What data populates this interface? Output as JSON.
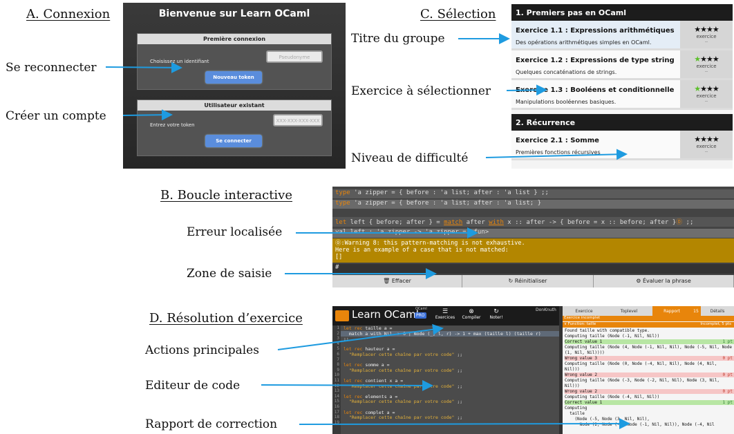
{
  "captions": {
    "a": "A. Connexion",
    "b": "B. Boucle interactive",
    "c": "C. Sélection",
    "d": "D. Résolution d’exercice"
  },
  "labels": {
    "reconnect": "Se reconnecter",
    "create": "Créer un compte",
    "group_title": "Titre du groupe",
    "exercise_select": "Exercice à sélectionner",
    "difficulty": "Niveau de difficulté",
    "error": "Erreur localisée",
    "input_zone": "Zone de saisie",
    "main_actions": "Actions principales",
    "code_editor": "Editeur de code",
    "report": "Rapport de correction"
  },
  "login": {
    "title": "Bienvenue sur Learn OCaml",
    "first_header": "Première connexion",
    "first_text": "Choisissez un identifiant",
    "first_placeholder": "Pseudonyme",
    "first_button": "Nouveau token",
    "existing_header": "Utilisateur existant",
    "existing_text": "Entrez votre token",
    "existing_placeholder": "XXX-XXX-XXX-XXX",
    "existing_button": "Se connecter"
  },
  "selection": {
    "groups": [
      {
        "title": "1. Premiers pas en OCaml",
        "exercises": [
          {
            "title": "Exercice 1.1 : Expressions arithmétiques",
            "desc": "Des opérations arithmétiques simples en OCaml.",
            "stars": "★★★★",
            "kind": "exercice",
            "extra": "--"
          },
          {
            "title": "Exercice 1.2 : Expressions de type string",
            "desc": "Quelques concaténations de strings.",
            "stars": "★★★★",
            "kind": "exercice",
            "extra": "--"
          },
          {
            "title": "Exercice 1.3 : Booléens et conditionnelle",
            "desc": "Manipulations booléennes basiques.",
            "stars": "★★★★",
            "kind": "exercice",
            "extra": "--"
          }
        ]
      },
      {
        "title": "2. Récurrence",
        "exercises": [
          {
            "title": "Exercice 2.1 : Somme",
            "desc": "Premières fonctions récursives",
            "stars": "★★★★",
            "kind": "exercice",
            "extra": "--"
          }
        ]
      }
    ]
  },
  "toplevel": {
    "lines": [
      {
        "kw": "type",
        "rest": " 'a zipper = { before : 'a list; after : 'a list } ;;"
      },
      {
        "kw": "type",
        "rest": " 'a zipper = { before : 'a list; after : 'a list; }"
      },
      {
        "kw1": "let",
        "a": " left { before; after } = ",
        "kw2": "match",
        "b": " after ",
        "kw3": "with",
        "c": " x :: after -> { before = x :: before; after }",
        "d": " ;;"
      },
      {
        "text": "val left : 'a zipper -> 'a zipper = <fun>"
      }
    ],
    "warning": [
      "Warning 8: this pattern-matching is not exhaustive.",
      "Here is an example of a case that is not matched:",
      "[]"
    ],
    "prompt": "#",
    "buttons": [
      "Effacer",
      "Réinitialiser",
      "Évaluer la phrase"
    ]
  },
  "editor": {
    "app_name": "Learn OCaml",
    "badge_top": "OCaml",
    "badge_pro": "PRO",
    "actions": [
      "Exercices",
      "Compiler",
      "Noter!"
    ],
    "user": "DonKnuth",
    "code": [
      {
        "kw": "let rec",
        "rest": " taille a ="
      },
      {
        "kw": "",
        "rest": "  match a with Nil -> 0 | Node (_, l, r) -> 1 + max (taille l) (taille r)"
      },
      {
        "kw": "",
        "rest": ";;"
      },
      {
        "kw": "",
        "rest": ""
      },
      {
        "kw": "let rec",
        "rest": " hauteur a ="
      },
      {
        "kw": "",
        "str": "  \"Remplacer cette chaîne par votre code\"",
        "rest": " ;;"
      },
      {
        "kw": "",
        "rest": ""
      },
      {
        "kw": "let rec",
        "rest": " somme a ="
      },
      {
        "kw": "",
        "str": "  \"Remplacer cette chaîne par votre code\"",
        "rest": " ;;"
      },
      {
        "kw": "",
        "rest": ""
      },
      {
        "kw": "let rec",
        "rest": " contient x a ="
      },
      {
        "kw": "",
        "str": "  \"Remplacer cette chaîne par votre code\"",
        "rest": " ;;"
      },
      {
        "kw": "",
        "rest": ""
      },
      {
        "kw": "let rec",
        "rest": " elements a ="
      },
      {
        "kw": "",
        "str": "  \"Remplacer cette chaîne par votre code\"",
        "rest": " ;;"
      },
      {
        "kw": "",
        "rest": ""
      },
      {
        "kw": "let rec",
        "rest": " complet a ="
      },
      {
        "kw": "",
        "str": "  \"Remplacer cette chaîne par votre code\"",
        "rest": " ;;"
      },
      {
        "kw": "",
        "rest": ""
      }
    ]
  },
  "report": {
    "tabs": [
      "Exercice",
      "Toplevel",
      "Rapport",
      "15",
      "Détails"
    ],
    "status": "Exercice incomplet",
    "fn_line": "∨ Function: taille",
    "fn_status": "Incomplet, 5 pts",
    "lines": [
      {
        "t": "Found taille with compatible type.",
        "c": "#f5f5f5",
        "p": ""
      },
      {
        "t": "Computing taille (Node (-1, Nil, Nil))",
        "c": "#f5f5f5",
        "p": ""
      },
      {
        "t": "Correct value 1",
        "c": "#b8e6a4",
        "p": "1 pt"
      },
      {
        "t": "Computing taille (Node (4, Node (-1, Nil, Nil), Node (-5, Nil, Node",
        "c": "#f5f5f5",
        "p": ""
      },
      {
        "t": "(1, Nil, Nil))))",
        "c": "#f5f5f5",
        "p": ""
      },
      {
        "t": "Wrong value 3",
        "c": "#f6c6c6",
        "p": "0 pt"
      },
      {
        "t": "Computing taille (Node (0, Node (-4, Nil, Nil), Node (4, Nil,",
        "c": "#f5f5f5",
        "p": ""
      },
      {
        "t": "Nil)))",
        "c": "#f5f5f5",
        "p": ""
      },
      {
        "t": "Wrong value 2",
        "c": "#f6c6c6",
        "p": "0 pt"
      },
      {
        "t": "Computing taille (Node (-3, Node (-2, Nil, Nil), Node (3, Nil,",
        "c": "#f5f5f5",
        "p": ""
      },
      {
        "t": "Nil)))",
        "c": "#f5f5f5",
        "p": ""
      },
      {
        "t": "Wrong value 2",
        "c": "#f6c6c6",
        "p": "0 pt"
      },
      {
        "t": "Computing taille (Node (-4, Nil, Nil))",
        "c": "#f5f5f5",
        "p": ""
      },
      {
        "t": "Correct value 1",
        "c": "#b8e6a4",
        "p": "1 pt"
      },
      {
        "t": "Computing",
        "c": "#f5f5f5",
        "p": ""
      },
      {
        "t": "  taille",
        "c": "#f5f5f5",
        "p": ""
      },
      {
        "t": "    (Node (-5, Node (3, Nil, Nil),",
        "c": "#f5f5f5",
        "p": ""
      },
      {
        "t": "      Node (2, Node (-2, Node (-1, Nil, Nil)), Node (-4, Nil",
        "c": "#f5f5f5",
        "p": ""
      }
    ]
  },
  "colors": {
    "arrow": "#1e9be0",
    "orange": "#e8850b",
    "warning_bg": "#b38600"
  }
}
